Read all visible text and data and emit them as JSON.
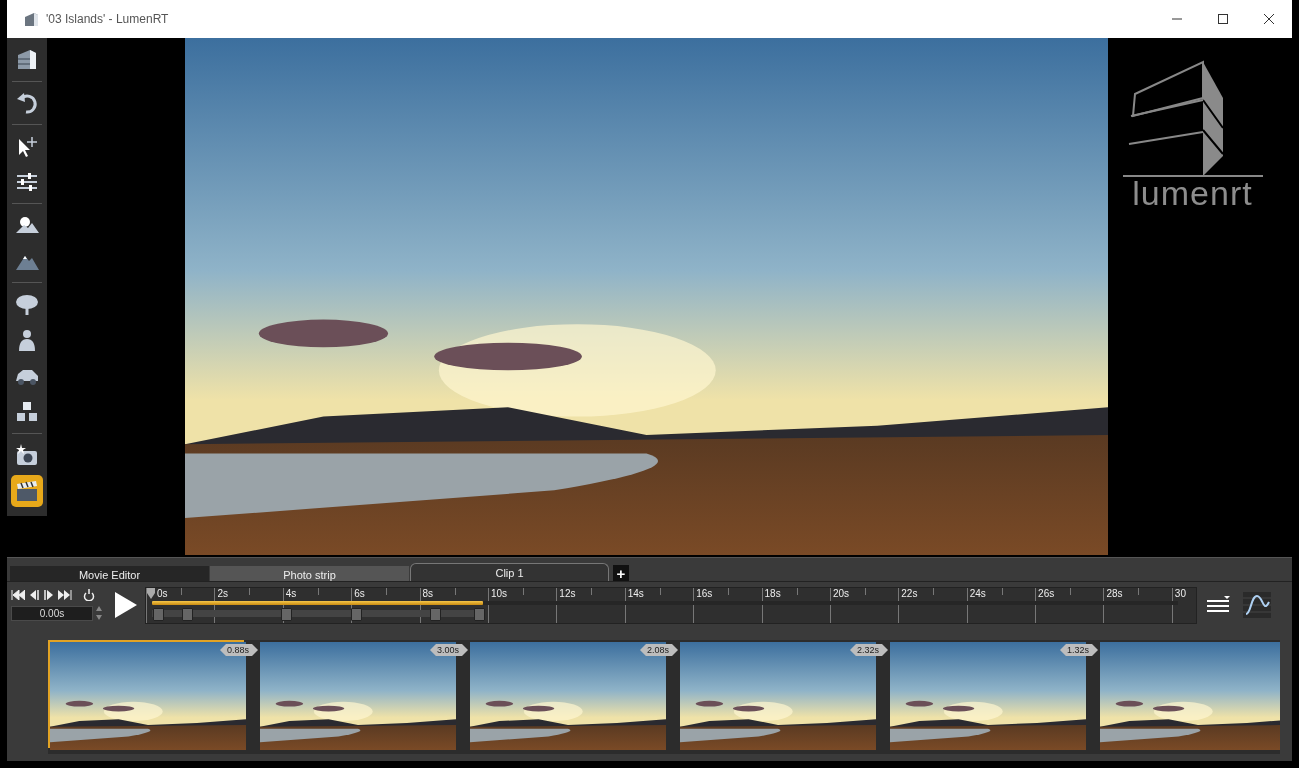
{
  "window": {
    "title": "'03 Islands' - LumenRT"
  },
  "toolbar": [
    {
      "selected": false
    },
    {
      "selected": false
    },
    {
      "selected": false
    },
    {
      "selected": false
    },
    {
      "selected": false
    },
    {
      "selected": false
    },
    {
      "selected": false
    },
    {
      "selected": false
    },
    {
      "selected": false
    },
    {
      "selected": false
    },
    {
      "selected": false
    },
    {
      "selected": true
    }
  ],
  "logo": {
    "text": "lumenrt"
  },
  "tabs": [
    {
      "label": "Movie Editor",
      "selected": false
    },
    {
      "label": "Photo strip",
      "selected": false
    },
    {
      "label": "Clip 1",
      "selected": true
    }
  ],
  "add_tab": "+",
  "transport": {
    "time": "0.00s"
  },
  "timeline": {
    "ticks": [
      "0s",
      "2s",
      "4s",
      "6s",
      "8s",
      "10s",
      "12s",
      "14s",
      "16s",
      "18s",
      "20s",
      "22s",
      "24s",
      "26s",
      "28s",
      "30"
    ],
    "clip_bar": {
      "level": 0.323
    }
  },
  "clips": [
    {
      "selected": true,
      "transition": "0.88s"
    },
    {
      "selected": false,
      "transition": "3.00s"
    },
    {
      "selected": false,
      "transition": "2.08s"
    },
    {
      "selected": false,
      "transition": "2.32s"
    },
    {
      "selected": false,
      "transition": "1.32s"
    },
    {
      "selected": false
    }
  ]
}
